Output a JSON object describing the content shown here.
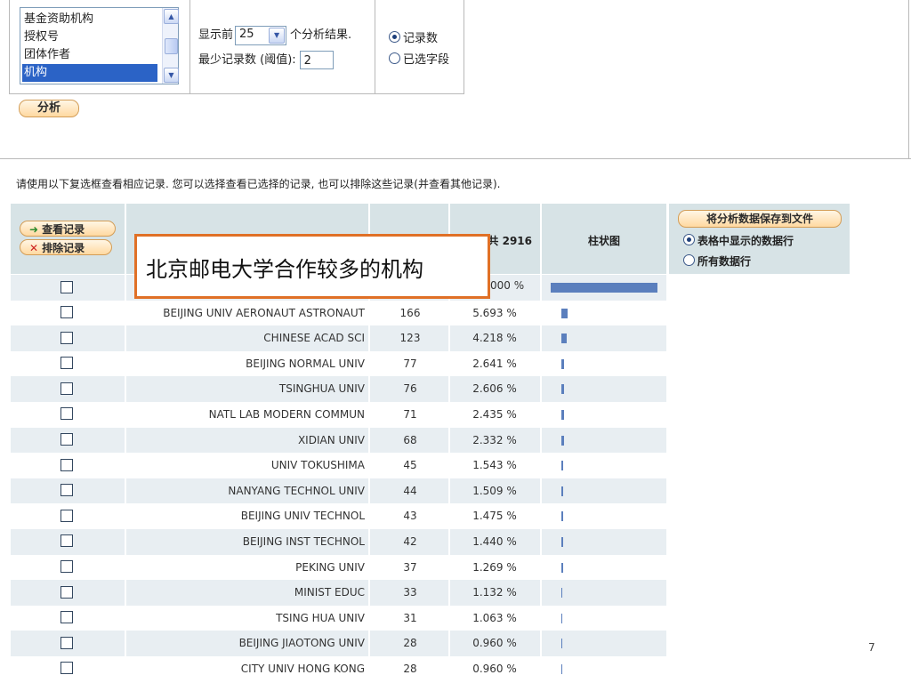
{
  "field_list": {
    "items": [
      "基金资助机构",
      "授权号",
      "团体作者",
      "机构"
    ],
    "selected_index": 3
  },
  "display_options": {
    "show_prefix": "显示前",
    "show_value": "25",
    "show_suffix": "个分析结果.",
    "min_label": "最少记录数 (阈值):",
    "min_value": "2"
  },
  "sort_options": {
    "record_count": "记录数",
    "selected_field": "已选字段",
    "selected": "record_count"
  },
  "analyze_button": "分析",
  "instructions": "请使用以下复选框查看相应记录. 您可以选择查看已选择的记录, 也可以排除这些记录(并查看其他记录).",
  "table": {
    "view_button": "查看记录",
    "exclude_button": "排除记录",
    "percent_header_fragment": "共 2916",
    "bar_header": "柱状图",
    "rows": [
      {
        "name": "BEIJING UNIV AERONAUT ASTRONAUT",
        "count": "166",
        "percent": "5.693 %",
        "fraction": 0.056
      },
      {
        "name": "CHINESE ACAD SCI",
        "count": "123",
        "percent": "4.218 %",
        "fraction": 0.042
      },
      {
        "name": "BEIJING NORMAL UNIV",
        "count": "77",
        "percent": "2.641 %",
        "fraction": 0.026
      },
      {
        "name": "TSINGHUA UNIV",
        "count": "76",
        "percent": "2.606 %",
        "fraction": 0.026
      },
      {
        "name": "NATL LAB MODERN COMMUN",
        "count": "71",
        "percent": "2.435 %",
        "fraction": 0.024
      },
      {
        "name": "XIDIAN UNIV",
        "count": "68",
        "percent": "2.332 %",
        "fraction": 0.023
      },
      {
        "name": "UNIV TOKUSHIMA",
        "count": "45",
        "percent": "1.543 %",
        "fraction": 0.015
      },
      {
        "name": "NANYANG TECHNOL UNIV",
        "count": "44",
        "percent": "1.509 %",
        "fraction": 0.015
      },
      {
        "name": "BEIJING UNIV TECHNOL",
        "count": "43",
        "percent": "1.475 %",
        "fraction": 0.015
      },
      {
        "name": "BEIJING INST TECHNOL",
        "count": "42",
        "percent": "1.440 %",
        "fraction": 0.014
      },
      {
        "name": "PEKING UNIV",
        "count": "37",
        "percent": "1.269 %",
        "fraction": 0.013
      },
      {
        "name": "MINIST EDUC",
        "count": "33",
        "percent": "1.132 %",
        "fraction": 0.011
      },
      {
        "name": "TSING HUA UNIV",
        "count": "31",
        "percent": "1.063 %",
        "fraction": 0.011
      },
      {
        "name": "BEIJING JIAOTONG UNIV",
        "count": "28",
        "percent": "0.960 %",
        "fraction": 0.0096
      },
      {
        "name": "CITY UNIV HONG KONG",
        "count": "28",
        "percent": "0.960 %",
        "fraction": 0.0096
      }
    ]
  },
  "first_row_partial": {
    "percent_fragment": "000 %",
    "fraction": 1.0
  },
  "save_panel": {
    "button": "将分析数据保存到文件",
    "option_table_rows": "表格中显示的数据行",
    "option_all_rows": "所有数据行",
    "selected": "table_rows"
  },
  "callout": {
    "text": "北京邮电大学合作较多的机构",
    "border_color": "#e07026"
  },
  "bar_color": "#5b7fbd",
  "page_number": "7"
}
